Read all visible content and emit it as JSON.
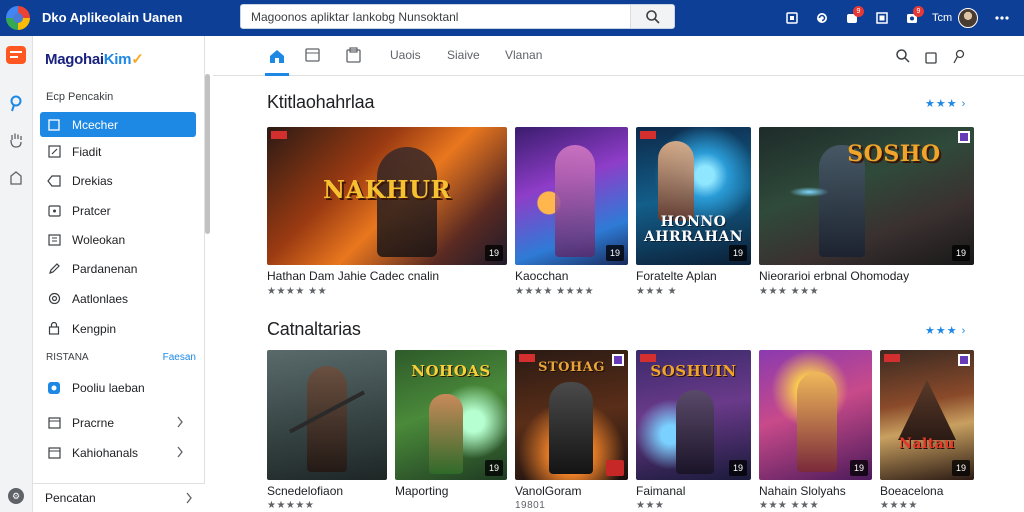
{
  "window": {
    "title": "Dko Aplikeolain Uanen"
  },
  "search": {
    "value": "Magoonos apliktar Iankobg Nunsoktanl"
  },
  "top_icons": [
    {
      "icon": "square-icon",
      "badge": ""
    },
    {
      "icon": "refresh-icon",
      "badge": ""
    },
    {
      "icon": "notification-icon",
      "badge": "9"
    },
    {
      "icon": "grid-icon",
      "badge": ""
    },
    {
      "icon": "alarm-icon",
      "badge": "9"
    }
  ],
  "user": {
    "name": "Tcm"
  },
  "sidebar": {
    "brand_main": "Magohai",
    "brand_accent": "Kim",
    "brand_suffix": "✓",
    "section_label": "Ecp Pencakin",
    "items": [
      {
        "label": "Mcecher",
        "icon": "home-icon",
        "active": true
      },
      {
        "label": "Fiadit",
        "icon": "edit-icon",
        "active": false
      },
      {
        "label": "Drekias",
        "icon": "tag-icon",
        "active": false
      },
      {
        "label": "Pratcer",
        "icon": "image-icon",
        "active": false
      },
      {
        "label": "Woleokan",
        "icon": "list-icon",
        "active": false
      },
      {
        "label": "Pardanenan",
        "icon": "pen-icon",
        "active": false
      },
      {
        "label": "Aatlonlaes",
        "icon": "settings-icon",
        "active": false
      },
      {
        "label": "Kengpin",
        "icon": "lock-icon",
        "active": false
      }
    ],
    "sub_header": "RISTANA",
    "sub_header_link": "Faesan",
    "sub_items": [
      {
        "label": "Pooliu laeban",
        "icon": "blue-dot-icon"
      },
      {
        "label": "Pracrne",
        "icon": "folder-icon"
      },
      {
        "label": "Kahiohanals",
        "icon": "folder-icon"
      }
    ],
    "footer": "Pencatan"
  },
  "tabs": {
    "labels": [
      "Uaois",
      "Siaive",
      "Vlanan"
    ]
  },
  "sections": [
    {
      "title": "Ktitlaohahrlaa",
      "more": "★★★ ›",
      "cards": [
        {
          "title": "Hathan Dam Jahie  Cadec cnalin",
          "meta": "★★★★ ★★",
          "corner": "19",
          "overlay": "NAKHUR"
        },
        {
          "title": "Kaocchan",
          "meta": "★★★★ ★★★★",
          "corner": "19",
          "overlay": ""
        },
        {
          "title": "Foratelte Aplan",
          "meta": "★★★ ★",
          "corner": "19",
          "overlay": "HONNO AHRRAHAN"
        },
        {
          "title": "Nieorarioi erbnal Ohomoday",
          "meta": "★★★ ★★★",
          "corner": "19",
          "overlay": "SOSHO"
        }
      ]
    },
    {
      "title": "Catnaltarias",
      "more": "★★★ ›",
      "cards": [
        {
          "title": "Scnedelofiaon",
          "meta": "★★★★★",
          "corner": "",
          "overlay": ""
        },
        {
          "title": "Maporting",
          "meta": "",
          "corner": "19",
          "overlay": "NOHOAS"
        },
        {
          "title": "VanolGoram",
          "meta": "19801",
          "corner": "",
          "overlay": "STOHAG"
        },
        {
          "title": "Faimanal",
          "meta": "★★★",
          "corner": "19",
          "overlay": "SOSHUIN"
        },
        {
          "title": "Nahain Slolyahs",
          "meta": "★★★ ★★★",
          "corner": "19",
          "overlay": ""
        },
        {
          "title": "Boeacelona",
          "meta": "★★★★",
          "corner": "19",
          "overlay": "Naltau"
        }
      ]
    }
  ]
}
